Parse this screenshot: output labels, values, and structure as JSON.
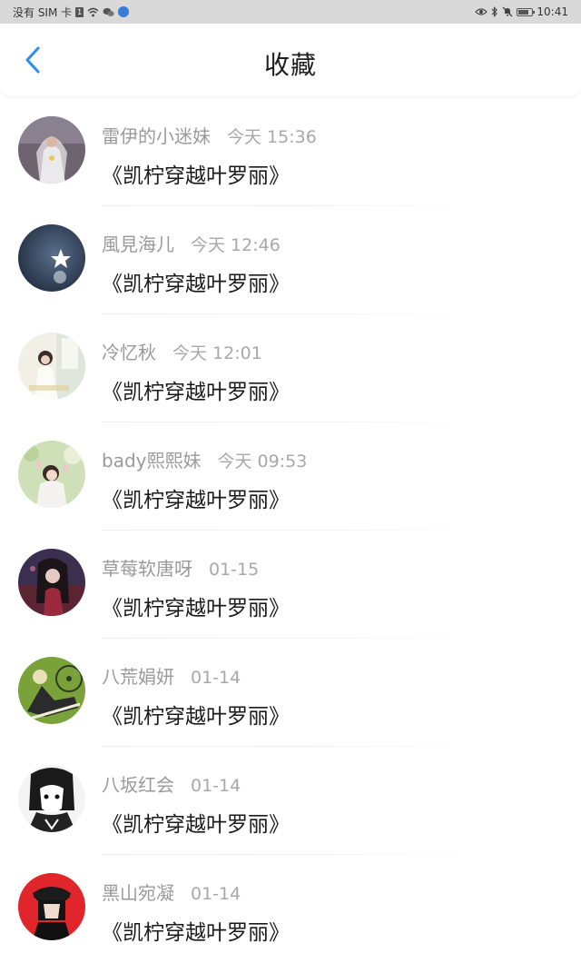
{
  "status_bar": {
    "carrier": "没有 SIM 卡",
    "time": "10:41",
    "icons": [
      "sim-badge-icon",
      "wifi-icon",
      "wechat-icon",
      "app-notification-icon",
      "eye-icon",
      "bluetooth-icon",
      "mute-bell-icon",
      "battery-icon"
    ]
  },
  "header": {
    "title": "收藏",
    "back_icon": "chevron-left-icon",
    "accent_color": "#2b8ef0"
  },
  "items": [
    {
      "user": "雷伊的小迷妹",
      "time": "今天 15:36",
      "book": "《凯柠穿越叶罗丽》",
      "avatar": "girl-in-white-dress"
    },
    {
      "user": "風見海儿",
      "time": "今天 12:46",
      "book": "《凯柠穿越叶罗丽》",
      "avatar": "star-dark-blue"
    },
    {
      "user": "冷忆秋",
      "time": "今天 12:01",
      "book": "《凯柠穿越叶罗丽》",
      "avatar": "girl-by-window"
    },
    {
      "user": "bady熙熙妹",
      "time": "今天 09:53",
      "book": "《凯柠穿越叶罗丽》",
      "avatar": "girl-with-flowers"
    },
    {
      "user": "草莓软唐呀",
      "time": "01-15",
      "book": "《凯柠穿越叶罗丽》",
      "avatar": "anime-dark-red"
    },
    {
      "user": "八荒娟妍",
      "time": "01-14",
      "book": "《凯柠穿越叶罗丽》",
      "avatar": "anime-green-bicycle"
    },
    {
      "user": "八坂红会",
      "time": "01-14",
      "book": "《凯柠穿越叶罗丽》",
      "avatar": "anime-monochrome"
    },
    {
      "user": "黑山宛凝",
      "time": "01-14",
      "book": "《凯柠穿越叶罗丽》",
      "avatar": "anime-red-hat"
    }
  ]
}
